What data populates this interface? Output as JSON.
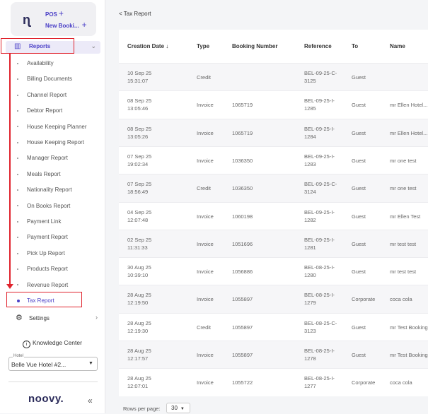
{
  "brand": {
    "pos_label": "POS",
    "new_booking_label": "New Booki...",
    "plus_glyph": "+"
  },
  "sidebar": {
    "reports_label": "Reports",
    "items": [
      {
        "label": "Availability"
      },
      {
        "label": "Billing Documents"
      },
      {
        "label": "Channel Report"
      },
      {
        "label": "Debtor Report"
      },
      {
        "label": "House Keeping Planner"
      },
      {
        "label": "House Keeping Report"
      },
      {
        "label": "Manager Report"
      },
      {
        "label": "Meals Report"
      },
      {
        "label": "Nationality Report"
      },
      {
        "label": "On Books Report"
      },
      {
        "label": "Payment Link"
      },
      {
        "label": "Payment Report"
      },
      {
        "label": "Pick Up Report"
      },
      {
        "label": "Products Report"
      },
      {
        "label": "Revenue Report"
      },
      {
        "label": "Tax Report",
        "active": true
      }
    ],
    "settings_label": "Settings",
    "knowledge_label": "Knowledge Center",
    "hotel_legend": "Hotel",
    "hotel_value": "Belle Vue Hotel #2...",
    "logo_text": "noovy.",
    "collapse_glyph": "«"
  },
  "breadcrumb": "< Tax Report",
  "table": {
    "headers": {
      "creation_date": "Creation Date",
      "sort_glyph": "↓",
      "type": "Type",
      "booking_number": "Booking Number",
      "reference": "Reference",
      "to": "To",
      "name": "Name"
    },
    "rows": [
      {
        "date": "10 Sep 25",
        "time": "15:31:07",
        "type": "Credit",
        "booking": "",
        "ref": "BEL-09-25-C-3125",
        "to": "Guest",
        "name": ""
      },
      {
        "date": "08 Sep 25",
        "time": "13:05:46",
        "type": "Invoice",
        "booking": "1065719",
        "ref": "BEL-09-25-I-1285",
        "to": "Guest",
        "name": "mr Ellen Hotel..."
      },
      {
        "date": "08 Sep 25",
        "time": "13:05:26",
        "type": "Invoice",
        "booking": "1065719",
        "ref": "BEL-09-25-I-1284",
        "to": "Guest",
        "name": "mr Ellen Hotel..."
      },
      {
        "date": "07 Sep 25",
        "time": "19:02:34",
        "type": "Invoice",
        "booking": "1036350",
        "ref": "BEL-09-25-I-1283",
        "to": "Guest",
        "name": "mr one test"
      },
      {
        "date": "07 Sep 25",
        "time": "18:56:49",
        "type": "Credit",
        "booking": "1036350",
        "ref": "BEL-09-25-C-3124",
        "to": "Guest",
        "name": "mr one test"
      },
      {
        "date": "04 Sep 25",
        "time": "12:07:48",
        "type": "Invoice",
        "booking": "1060198",
        "ref": "BEL-09-25-I-1282",
        "to": "Guest",
        "name": "mr Ellen Test"
      },
      {
        "date": "02 Sep 25",
        "time": "11:31:33",
        "type": "Invoice",
        "booking": "1051696",
        "ref": "BEL-09-25-I-1281",
        "to": "Guest",
        "name": "mr test test"
      },
      {
        "date": "30 Aug 25",
        "time": "10:39:10",
        "type": "Invoice",
        "booking": "1056886",
        "ref": "BEL-08-25-I-1280",
        "to": "Guest",
        "name": "mr test test"
      },
      {
        "date": "28 Aug 25",
        "time": "12:19:50",
        "type": "Invoice",
        "booking": "1055897",
        "ref": "BEL-08-25-I-1279",
        "to": "Corporate",
        "name": "coca cola"
      },
      {
        "date": "28 Aug 25",
        "time": "12:19:30",
        "type": "Credit",
        "booking": "1055897",
        "ref": "BEL-08-25-C-3123",
        "to": "Guest",
        "name": "mr Test Booking"
      },
      {
        "date": "28 Aug 25",
        "time": "12:17:57",
        "type": "Invoice",
        "booking": "1055897",
        "ref": "BEL-08-25-I-1278",
        "to": "Guest",
        "name": "mr Test Booking"
      },
      {
        "date": "28 Aug 25",
        "time": "12:07:01",
        "type": "Invoice",
        "booking": "1055722",
        "ref": "BEL-08-25-I-1277",
        "to": "Corporate",
        "name": "coca cola"
      }
    ]
  },
  "footer": {
    "rows_per_page_label": "Rows per page:",
    "rows_per_page_value": "30"
  },
  "colors": {
    "accent": "#4a3fc7",
    "highlight": "#e0232d"
  }
}
